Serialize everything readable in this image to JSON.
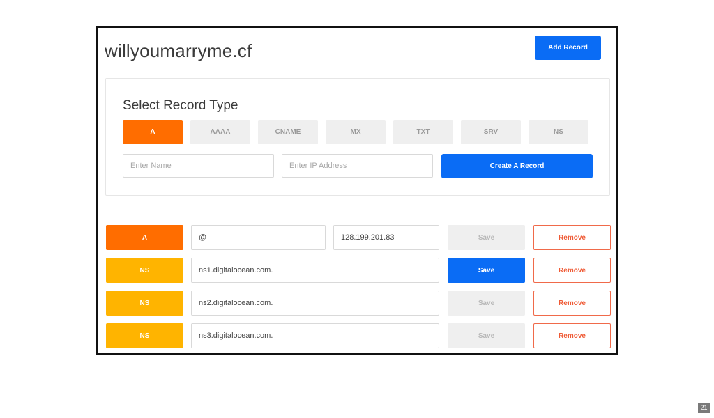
{
  "header": {
    "domain": "willyoumarryme.cf",
    "add_record_label": "Add Record"
  },
  "form": {
    "title": "Select Record Type",
    "types": [
      "A",
      "AAAA",
      "CNAME",
      "MX",
      "TXT",
      "SRV",
      "NS"
    ],
    "selected_type": "A",
    "name_placeholder": "Enter Name",
    "ip_placeholder": "Enter IP Address",
    "create_label": "Create A Record"
  },
  "records": [
    {
      "type": "A",
      "name": "@",
      "value": "128.199.201.83",
      "save": "Save",
      "save_enabled": false,
      "remove": "Remove"
    },
    {
      "type": "NS",
      "value": "ns1.digitalocean.com.",
      "save": "Save",
      "save_enabled": true,
      "remove": "Remove"
    },
    {
      "type": "NS",
      "value": "ns2.digitalocean.com.",
      "save": "Save",
      "save_enabled": false,
      "remove": "Remove"
    },
    {
      "type": "NS",
      "value": "ns3.digitalocean.com.",
      "save": "Save",
      "save_enabled": false,
      "remove": "Remove"
    }
  ],
  "colors": {
    "accent_blue": "#0a6cf5",
    "type_a": "#ff6d00",
    "type_ns": "#ffb400",
    "remove_red": "#ef5a35"
  },
  "slide_number": "21"
}
